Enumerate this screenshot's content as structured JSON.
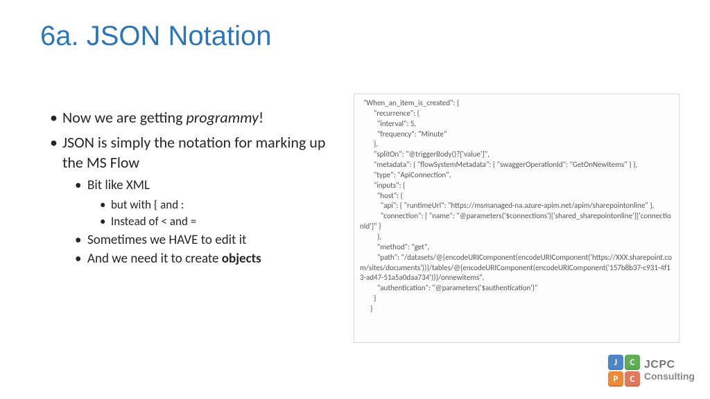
{
  "title": "6a. JSON Notation",
  "bullets": {
    "b1_a": "Now we are getting ",
    "b1_em": "programmy",
    "b1_b": "!",
    "b2": "JSON is simply the notation for marking up the MS Flow",
    "b2_1": "Bit like XML",
    "b2_1_1": "but with { and :",
    "b2_1_2": "Instead of < and =",
    "b2_2": "Sometimes we HAVE to edit it",
    "b2_3_a": "And we need it to create ",
    "b2_3_bold": "objects"
  },
  "code": "  \"When_an_item_is_created\": {\n        \"recurrence\": {\n          \"interval\": 5,\n          \"frequency\": \"Minute\"\n        },\n        \"splitOn\": \"@triggerBody()?['value']\",\n        \"metadata\": { \"flowSystemMetadata\": { \"swaggerOperationId\": \"GetOnNewItems\" } },\n        \"type\": \"ApiConnection\",\n        \"inputs\": {\n          \"host\": {\n            \"api\": { \"runtimeUrl\": \"https://msmanaged-na.azure-apim.net/apim/sharepointonline\" },\n            \"connection\": { \"name\": \"@parameters('$connections')['shared_sharepointonline']['connectionId']\" }\n          },\n          \"method\": \"get\",\n          \"path\": \"/datasets/@{encodeURIComponent(encodeURIComponent('https://XXX.sharepoint.com/sites/documents'))}/tables/@{encodeURIComponent(encodeURIComponent('157b8b37-c931-4f13-ad47-51a5a0daa734'))}/onnewitems\",\n          \"authentication\": \"@parameters('$authentication')\"\n        }\n      }",
  "logo": {
    "tiles": {
      "j": "J",
      "c1": "C",
      "p": "P",
      "c2": "C"
    },
    "line1": "JCPC",
    "line2": "Consulting"
  }
}
